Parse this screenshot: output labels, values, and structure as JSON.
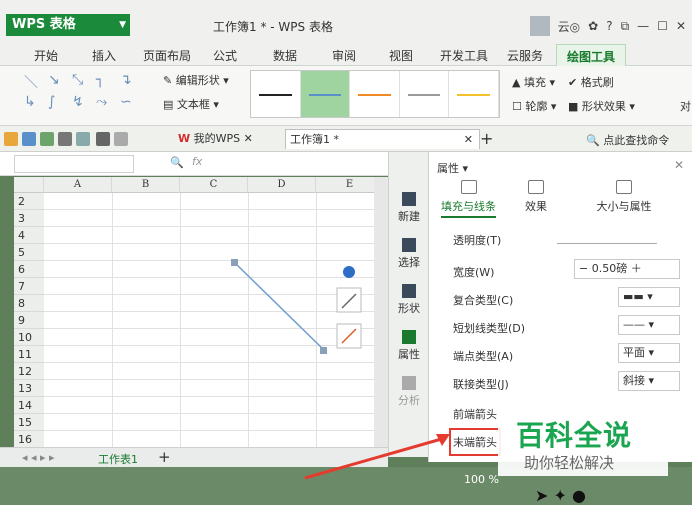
{
  "app": {
    "logo": "WPS 表格",
    "title": "工作簿1 * - WPS 表格",
    "user_glyph": "云◎"
  },
  "tabs": [
    "开始",
    "插入",
    "页面布局",
    "公式",
    "数据",
    "审阅",
    "视图",
    "开发工具",
    "云服务",
    "绘图工具"
  ],
  "ribbon": {
    "edit_shape": "编辑形状",
    "textbox": "文本框",
    "fill": "填充",
    "format_brush": "格式刷",
    "outline": "轮廓",
    "shape_effect": "形状效果",
    "tail": "对"
  },
  "doc": {
    "mywps": "我的WPS",
    "workbook": "工作簿1 *",
    "find_cmd": "点此查找命令"
  },
  "formula": {
    "fx": "fx"
  },
  "columns": [
    "A",
    "B",
    "C",
    "D",
    "E"
  ],
  "rows": [
    "2",
    "3",
    "4",
    "5",
    "6",
    "7",
    "8",
    "9",
    "10",
    "11",
    "12",
    "13",
    "14",
    "15",
    "16"
  ],
  "sidebar": [
    "新建",
    "选择",
    "形状",
    "属性",
    "分析"
  ],
  "panel": {
    "title": "属性",
    "tabs": [
      "填充与线条",
      "效果",
      "大小与属性"
    ],
    "transparency": "透明度(T)",
    "width": "宽度(W)",
    "width_value": "0.50磅",
    "compound": "复合类型(C)",
    "dash": "短划线类型(D)",
    "cap": "端点类型(A)",
    "cap_value": "平面",
    "join": "联接类型(J)",
    "join_value": "斜接",
    "start_arrow": "前端箭头",
    "end_arrow": "末端箭头"
  },
  "status": {
    "sheet_tab": "工作表1",
    "zoom": "100 %"
  },
  "watermark": {
    "line1": "百科全说",
    "line2": "助你轻松解决"
  }
}
